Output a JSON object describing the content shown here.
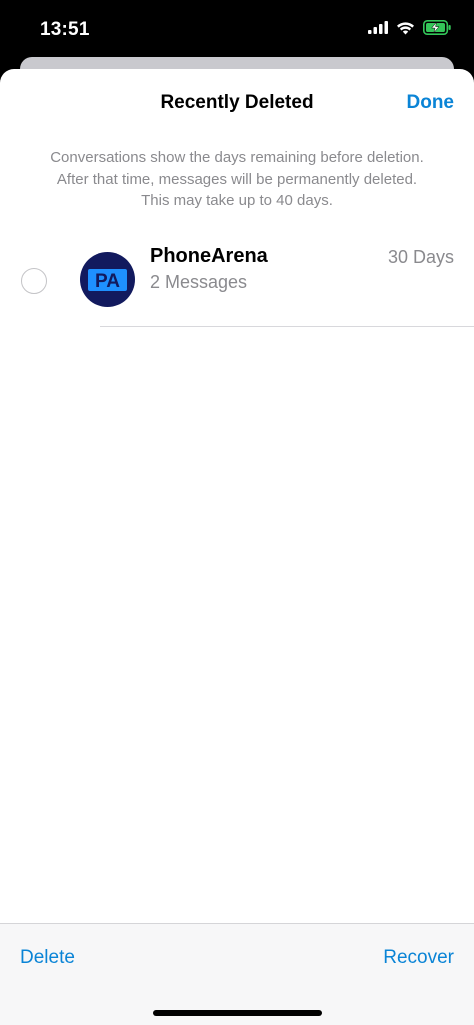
{
  "status_bar": {
    "time": "13:51",
    "icons": [
      "cellular-signal-icon",
      "wifi-icon",
      "battery-charging-icon"
    ],
    "battery_color": "#34c759"
  },
  "header": {
    "title": "Recently Deleted",
    "done_label": "Done"
  },
  "info": {
    "lines": [
      "Conversations show the days remaining before deletion.",
      "After that time, messages will be permanently deleted.",
      "This may take up to 40 days."
    ]
  },
  "conversations": [
    {
      "name": "PhoneArena",
      "subtitle": "2 Messages",
      "days_remaining": "30 Days",
      "avatar_icon": "phonearena-logo-icon",
      "avatar_text": "PA",
      "selected": false
    }
  ],
  "toolbar": {
    "delete_label": "Delete",
    "recover_label": "Recover"
  },
  "colors": {
    "accent": "#0a84d6",
    "secondary_text": "#8a8a8e",
    "avatar_bg": "#121a5e",
    "avatar_logo": "#1e90ff"
  }
}
